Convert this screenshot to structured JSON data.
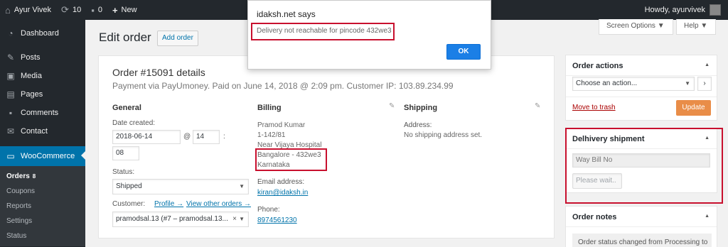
{
  "adminbar": {
    "site_name": "Ayur Vivek",
    "updates_count": "10",
    "comments_count": "0",
    "new_label": "New",
    "howdy": "Howdy, ayurvivek"
  },
  "sidebar": {
    "dashboard": "Dashboard",
    "posts": "Posts",
    "media": "Media",
    "pages": "Pages",
    "comments": "Comments",
    "contact": "Contact",
    "woocommerce": "WooCommerce",
    "submenu": {
      "orders": "Orders",
      "orders_count": "8",
      "coupons": "Coupons",
      "reports": "Reports",
      "settings": "Settings",
      "status": "Status"
    }
  },
  "header": {
    "title": "Edit order",
    "add_order": "Add order",
    "screen_options": "Screen Options ▼",
    "help": "Help ▼"
  },
  "order": {
    "heading": "Order #15091 details",
    "meta": "Payment via PayUmoney. Paid on June 14, 2018 @ 2:09 pm. Customer IP: 103.89.234.99",
    "general": {
      "title": "General",
      "date_label": "Date created:",
      "date_value": "2018-06-14",
      "at": "@",
      "hour": "14",
      "colon": ":",
      "minute": "08",
      "status_label": "Status:",
      "status_value": "Shipped",
      "customer_label": "Customer:",
      "profile_link": "Profile →",
      "other_orders_link": "View other orders →",
      "customer_value": "pramodsal.13 (#7 – pramodsal.13...",
      "clear": "×"
    },
    "billing": {
      "title": "Billing",
      "name": "Pramod Kumar",
      "line1": "1-142/81",
      "line2": "Near Vijaya Hospital",
      "line3": "Bangalore - 432we3",
      "line4": "Karnataka",
      "email_label": "Email address:",
      "email": "kiran@idaksh.in",
      "phone_label": "Phone:",
      "phone": "8974561230"
    },
    "shipping": {
      "title": "Shipping",
      "address_label": "Address:",
      "address_value": "No shipping address set."
    }
  },
  "order_actions": {
    "title": "Order actions",
    "select": "Choose an action...",
    "go": "›",
    "trash": "Move to trash",
    "update": "Update"
  },
  "delhivery": {
    "title": "Delhivery shipment",
    "waybill_placeholder": "Way Bill No",
    "wait_button": "Please wait.."
  },
  "order_notes": {
    "title": "Order notes",
    "note_text": "Order status changed from Processing to"
  },
  "alert": {
    "title": "idaksh.net says",
    "message": "Delivery not reachable for pincode 432we3",
    "ok": "OK"
  }
}
